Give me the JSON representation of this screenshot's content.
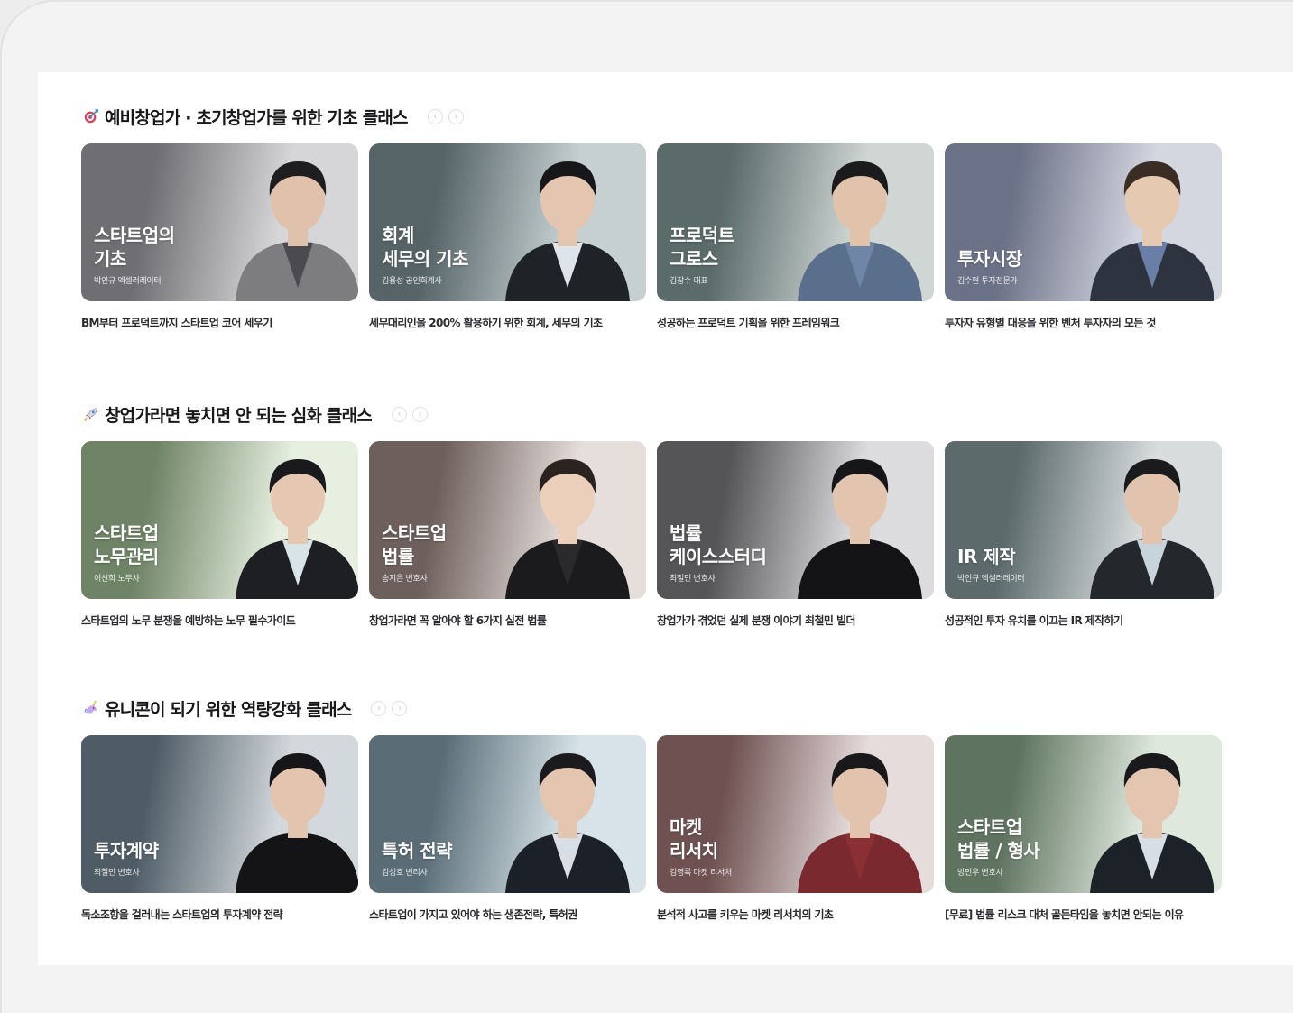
{
  "sections": [
    {
      "title": "예비창업가 · 초기창업가를 위한 기초 클래스",
      "emoji": "target-icon",
      "cards": [
        {
          "title": "스타트업의\n기초",
          "subtitle": "박인규 엑셀러레이터",
          "desc": "BM부터 프로덕트까지 스타트업 코어 세우기",
          "bg": "#6f6f73",
          "bg2": "#d6d6d8",
          "suit": "#7d7d80",
          "inner": "#4b4b4f",
          "skin": "#e0c1ac",
          "hair": "#1e1e20"
        },
        {
          "title": "회계\n세무의 기초",
          "subtitle": "김용성 공인회계사",
          "desc": "세무대리인을 200% 활용하기 위한 회계, 세무의 기초",
          "bg": "#566468",
          "bg2": "#c6d0d1",
          "suit": "#1f2328",
          "inner": "#dfe4ea",
          "skin": "#e4c6b0",
          "hair": "#17171a"
        },
        {
          "title": "프로덕트\n그로스",
          "subtitle": "김창수 대표",
          "desc": "성공하는 프로덕트 기획을 위한 프레임워크",
          "bg": "#5a6b6a",
          "bg2": "#cfd6d4",
          "suit": "#5a6f8c",
          "inner": "#6f86a6",
          "skin": "#e1c2ab",
          "hair": "#1b1b1d"
        },
        {
          "title": "투자시장",
          "subtitle": "김수현 투자전문가",
          "desc": "투자자 유형별 대응을 위한 벤처 투자자의 모든 것",
          "bg": "#6b7186",
          "bg2": "#d4d6e0",
          "suit": "#2e3340",
          "inner": "#6a7fa8",
          "skin": "#e6c9b1",
          "hair": "#3a2d24"
        }
      ]
    },
    {
      "title": "창업가라면 놓치면 안 되는 심화 클래스",
      "emoji": "rocket-icon",
      "cards": [
        {
          "title": "스타트업\n노무관리",
          "subtitle": "이선희 노무사",
          "desc": "스타트업의 노무 분쟁을 예방하는 노무 필수가이드",
          "bg": "#6f8366",
          "bg2": "#e6efe0",
          "suit": "#1d1f22",
          "inner": "#d8e4e8",
          "skin": "#e6c8b2",
          "hair": "#1a1a1c"
        },
        {
          "title": "스타트업\n법률",
          "subtitle": "송지은 변호사",
          "desc": "창업가라면 꼭 알아야 할 6가지 실전 법률",
          "bg": "#6d5f5c",
          "bg2": "#e6dedb",
          "suit": "#1b1b1d",
          "inner": "#2a2a2c",
          "skin": "#eccfbb",
          "hair": "#2a2320"
        },
        {
          "title": "법률\n케이스스터디",
          "subtitle": "최철민 변호사",
          "desc": "창업가가 겪었던 실제 분쟁 이야기 최철민 빌더",
          "bg": "#555558",
          "bg2": "#dcdcde",
          "suit": "#141416",
          "inner": "#141416",
          "skin": "#e3c4ae",
          "hair": "#161618"
        },
        {
          "title": "IR 제작",
          "subtitle": "박인규 엑셀러레이터",
          "desc": "성공적인 투자 유치를 이끄는 IR 제작하기",
          "bg": "#5c6a6c",
          "bg2": "#d8dcdd",
          "suit": "#24282c",
          "inner": "#c8d4dc",
          "skin": "#e2c3ad",
          "hair": "#1b1b1d"
        }
      ]
    },
    {
      "title": "유니콘이 되기 위한 역량강화 클래스",
      "emoji": "unicorn-icon",
      "cards": [
        {
          "title": "투자계약",
          "subtitle": "최철민 변호사",
          "desc": "독소조항을 걸러내는 스타트업의 투자계약 전략",
          "bg": "#4f5c66",
          "bg2": "#d3d8dc",
          "suit": "#141416",
          "inner": "#141416",
          "skin": "#e3c4ae",
          "hair": "#161618"
        },
        {
          "title": "특허 전략",
          "subtitle": "김성호 변리사",
          "desc": "스타트업이 가지고 있어야 하는 생존전략, 특허권",
          "bg": "#5a6d77",
          "bg2": "#d7e3e8",
          "suit": "#1c2028",
          "inner": "#d9dde4",
          "skin": "#e4c6b0",
          "hair": "#1b1b1d"
        },
        {
          "title": "마켓\n리서치",
          "subtitle": "김영록 마켓 리서처",
          "desc": "분석적 사고를 키우는 마켓 리서치의 기초",
          "bg": "#6f5151",
          "bg2": "#e6dcdc",
          "suit": "#7a2a2e",
          "inner": "#8a3035",
          "skin": "#e2c3ad",
          "hair": "#19191b"
        },
        {
          "title": "스타트업\n법률 / 형사",
          "subtitle": "방민우 변호사",
          "desc": "[무료] 법률 리스크 대처 골든타임을 놓치면 안되는 이유",
          "bg": "#5f7460",
          "bg2": "#dfe8dd",
          "suit": "#1d2128",
          "inner": "#d7dee6",
          "skin": "#e4c6b0",
          "hair": "#1a1a1c"
        }
      ]
    }
  ]
}
